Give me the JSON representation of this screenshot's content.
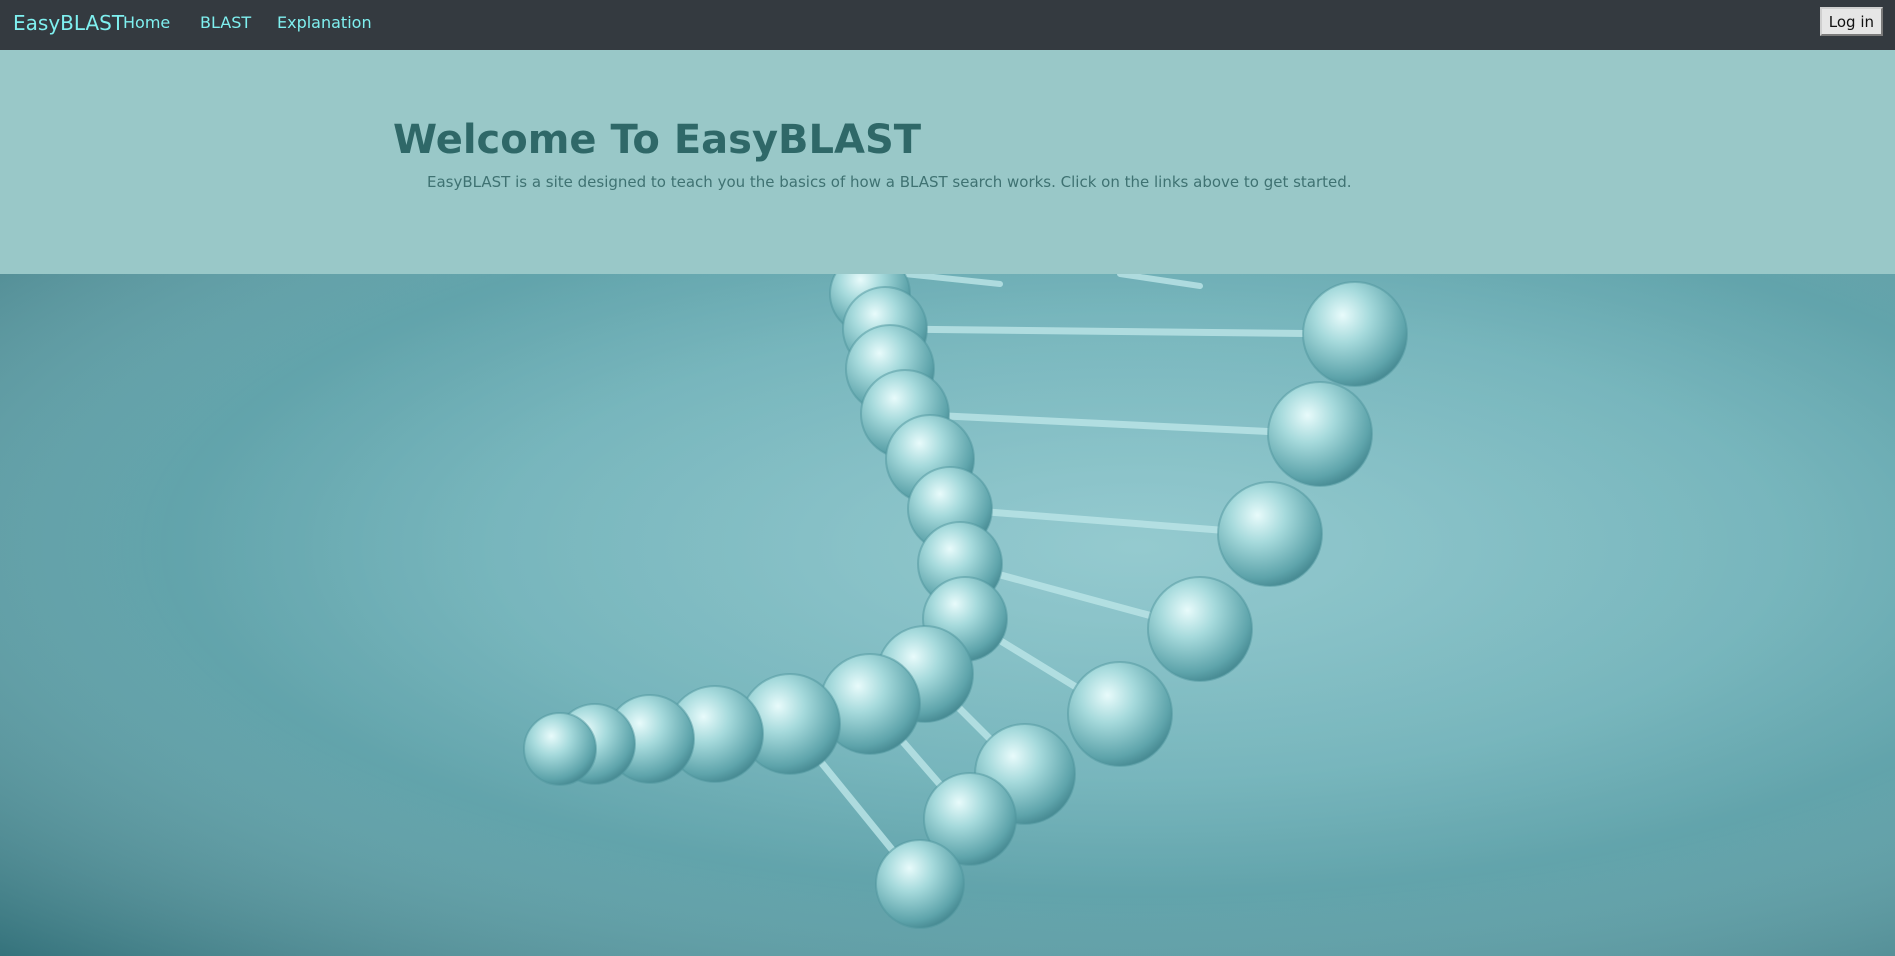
{
  "navbar": {
    "brand": "EasyBLAST",
    "links": [
      {
        "label": "Home"
      },
      {
        "label": "BLAST"
      },
      {
        "label": "Explanation"
      }
    ],
    "login_label": "Log in"
  },
  "jumbotron": {
    "title": "Welcome To EasyBLAST",
    "text": "EasyBLAST is a site designed to teach you the basics of how a BLAST search works. Click on the links above to get started."
  },
  "hero": {
    "image": "dna-helix-image"
  },
  "colors": {
    "navbar_bg": "#343a40",
    "nav_link": "#7ff0f0",
    "jumbotron_bg": "#99c8c8",
    "title": "#2f6868",
    "hero_teal": "#72b3ba"
  }
}
